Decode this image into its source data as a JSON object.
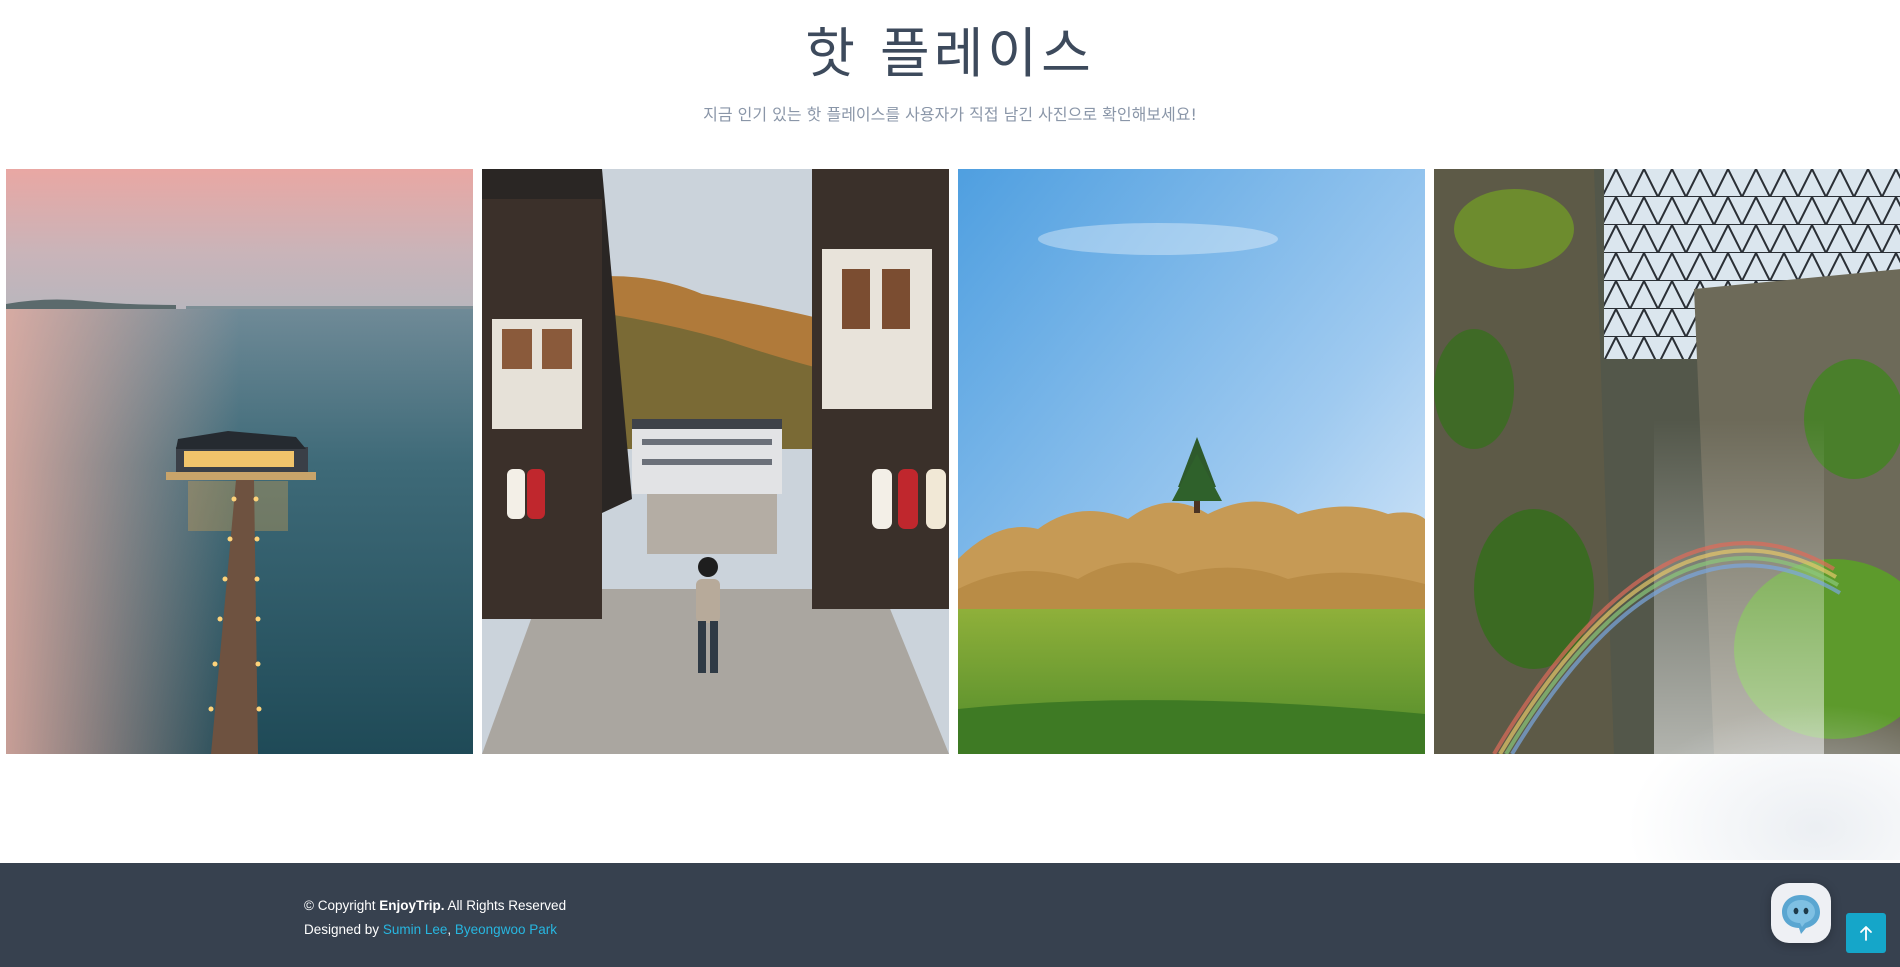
{
  "hot_places": {
    "title": "핫 플레이스",
    "subtitle": "지금 인기 있는 핫 플레이스를 사용자가 직접 남긴 사진으로 확인해보세요!"
  },
  "gallery": {
    "items": [
      {
        "scene": "house-on-water-at-dusk-photo"
      },
      {
        "scene": "japanese-style-street-photo"
      },
      {
        "scene": "grassy-hills-with-tree-photo"
      },
      {
        "scene": "indoor-garden-waterfall-rainbow-photo"
      }
    ]
  },
  "footer": {
    "copyright_prefix": "© Copyright",
    "brand": "EnjoyTrip.",
    "rights": "All Rights Reserved",
    "designed_by": "Designed by",
    "author1": "Sumin Lee",
    "separator": ",",
    "author2": "Byeongwoo Park"
  },
  "icons": {
    "chat": "chat-bot-icon",
    "scroll_top": "arrow-up-icon"
  },
  "colors": {
    "footer_bg": "#37414f",
    "link": "#27b6e0",
    "scroll_top_bg": "#15a6c9",
    "title": "#3d4a5c",
    "subtitle": "#8a96a8"
  }
}
